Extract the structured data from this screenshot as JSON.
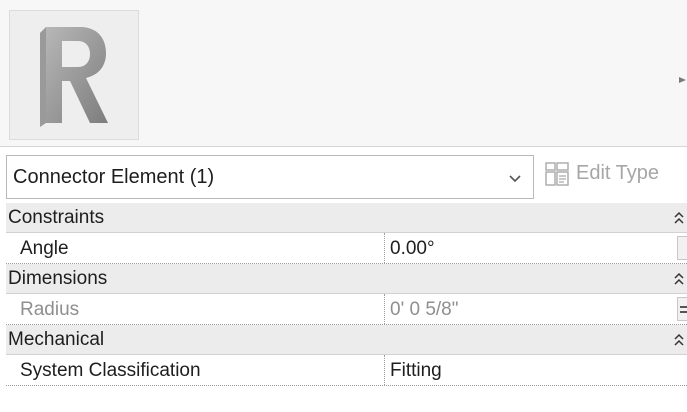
{
  "preview": {
    "logo_letter": "R"
  },
  "type_selector": {
    "selected": "Connector Element (1)",
    "edit_type_label": "Edit Type"
  },
  "groups": [
    {
      "label": "Constraints",
      "rows": [
        {
          "name": "Angle",
          "value": "0.00°",
          "editable": true
        }
      ]
    },
    {
      "label": "Dimensions",
      "rows": [
        {
          "name": "Radius",
          "value": "0'  0 5/8\"",
          "editable": false
        }
      ]
    },
    {
      "label": "Mechanical",
      "rows": [
        {
          "name": "System Classification",
          "value": "Fitting",
          "editable": true
        }
      ]
    }
  ],
  "colors": {
    "group_header_bg": "#ececec",
    "disabled_text": "#8f8f8f",
    "logo_gray": "#8a8a8a"
  }
}
